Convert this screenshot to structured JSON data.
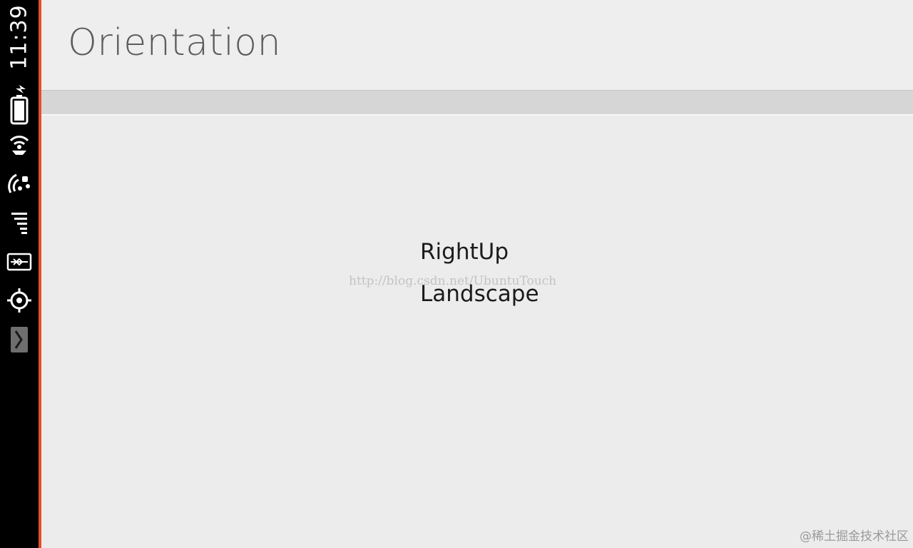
{
  "status_bar": {
    "time": "11:39",
    "icons": [
      "battery-charging-icon",
      "speaker-icon",
      "wifi-icon",
      "cellular-signal-icon",
      "bluetooth-icon",
      "location-icon",
      "launcher-chevron-icon"
    ],
    "accent_color": "#e0502b"
  },
  "header": {
    "title": "Orientation"
  },
  "main": {
    "rotation_label": "RightUp",
    "orientation_label": "Landscape",
    "watermark": "http://blog.csdn.net/UbuntuTouch"
  },
  "corner_watermark": "@稀土掘金技术社区"
}
